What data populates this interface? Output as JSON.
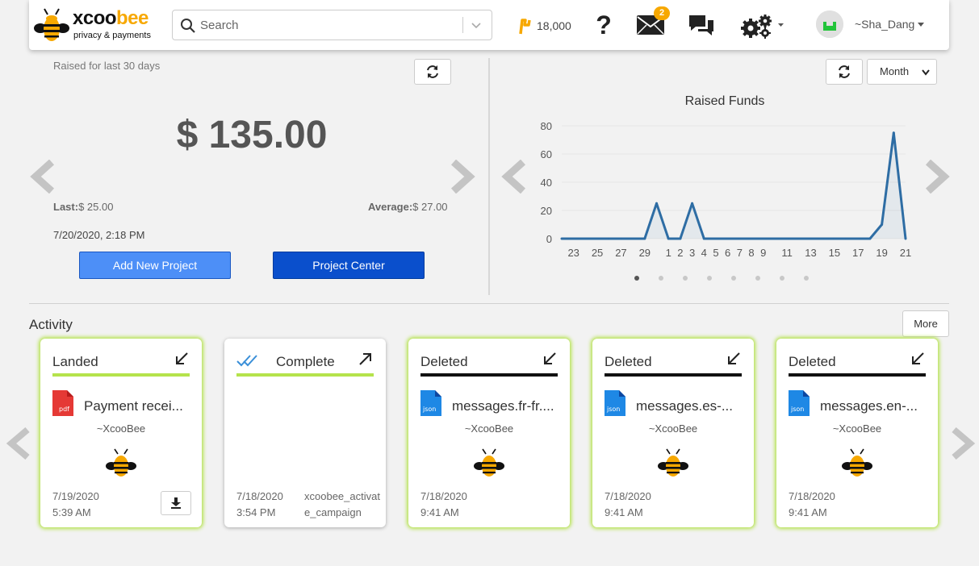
{
  "header": {
    "logo_text_a": "xcoo",
    "logo_text_b": "bee",
    "logo_sub": "privacy & payments",
    "search_placeholder": "Search",
    "points": "18,000",
    "messages_badge": "2",
    "username": "~Sha_Dang",
    "brand_color": "#f7a800"
  },
  "funds": {
    "raised_label": "Raised for last 30 days",
    "amount": "$ 135.00",
    "last_label": "Last:",
    "last_value": "$ 25.00",
    "average_label": "Average:",
    "average_value": "$ 27.00",
    "datetime": "7/20/2020, 2:18 PM",
    "add_project_label": "Add New Project",
    "project_center_label": "Project Center"
  },
  "chart_controls": {
    "period": "Month",
    "page_count": 8,
    "active_page": 0
  },
  "chart_data": {
    "type": "area",
    "title": "Raised Funds",
    "xlabel": "",
    "ylabel": "",
    "ylim": [
      0,
      80
    ],
    "yticks": [
      0,
      20,
      40,
      60,
      80
    ],
    "grid": true,
    "x": [
      "22",
      "23",
      "24",
      "25",
      "26",
      "27",
      "28",
      "29",
      "30",
      "1",
      "2",
      "3",
      "4",
      "5",
      "6",
      "7",
      "8",
      "9",
      "10",
      "11",
      "12",
      "13",
      "14",
      "15",
      "16",
      "17",
      "18",
      "19",
      "20",
      "21"
    ],
    "xtick_labels": [
      "23",
      "25",
      "27",
      "29",
      "1",
      "2",
      "3",
      "4",
      "5",
      "6",
      "7",
      "8",
      "9",
      "11",
      "13",
      "15",
      "17",
      "19",
      "21"
    ],
    "values": [
      0,
      0,
      0,
      0,
      0,
      0,
      0,
      0,
      25,
      0,
      0,
      25,
      0,
      0,
      0,
      0,
      0,
      0,
      0,
      0,
      0,
      0,
      0,
      0,
      0,
      0,
      0,
      10,
      75,
      0
    ],
    "line_color": "#2e6da4"
  },
  "activity": {
    "title": "Activity",
    "more_label": "More",
    "cards": [
      {
        "status": "Landed",
        "direction": "in",
        "line_color": "#b5e34c",
        "file_type": "pdf",
        "filename": "Payment recei...",
        "sender": "~XcooBee",
        "date": "7/19/2020",
        "time": "5:39 AM",
        "extra": "",
        "download": true,
        "glow": "green"
      },
      {
        "status": "Complete",
        "direction": "out",
        "line_color": "#b5e34c",
        "file_type": "",
        "filename": "",
        "sender": "",
        "date": "7/18/2020",
        "time": "3:54 PM",
        "extra": "xcoobee_activate_campaign",
        "download": false,
        "glow": "grey"
      },
      {
        "status": "Deleted",
        "direction": "in",
        "line_color": "#111111",
        "file_type": "json",
        "filename": "messages.fr-fr....",
        "sender": "~XcooBee",
        "date": "7/18/2020",
        "time": "9:41 AM",
        "extra": "",
        "download": false,
        "glow": "green"
      },
      {
        "status": "Deleted",
        "direction": "in",
        "line_color": "#111111",
        "file_type": "json",
        "filename": "messages.es-...",
        "sender": "~XcooBee",
        "date": "7/18/2020",
        "time": "9:41 AM",
        "extra": "",
        "download": false,
        "glow": "green"
      },
      {
        "status": "Deleted",
        "direction": "in",
        "line_color": "#111111",
        "file_type": "json",
        "filename": "messages.en-...",
        "sender": "~XcooBee",
        "date": "7/18/2020",
        "time": "9:41 AM",
        "extra": "",
        "download": false,
        "glow": "green"
      }
    ]
  }
}
